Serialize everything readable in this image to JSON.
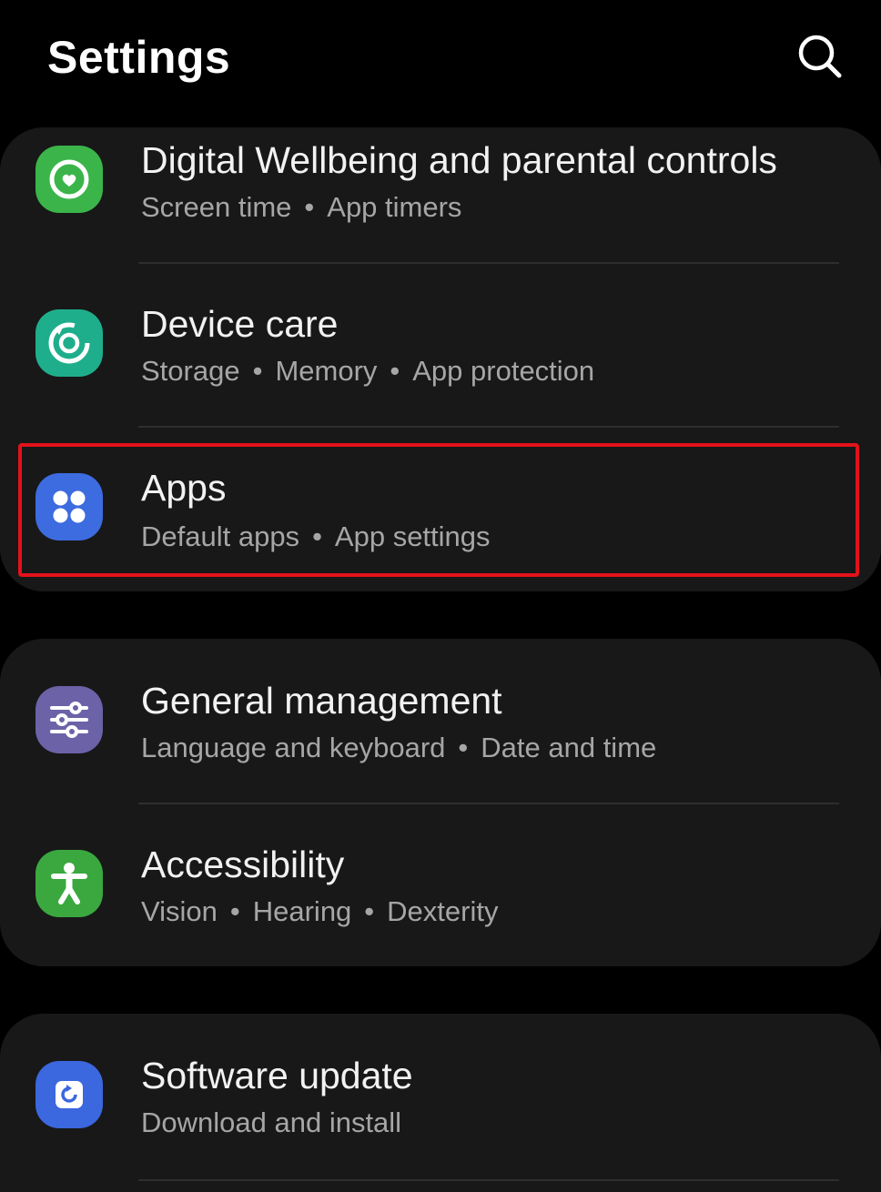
{
  "header": {
    "title": "Settings",
    "search_icon": "search-icon"
  },
  "groups": [
    {
      "items": [
        {
          "title": "Digital Wellbeing and parental controls",
          "subtitle_parts": [
            "Screen time",
            "App timers"
          ],
          "icon": "wellbeing-icon",
          "icon_color": "#3bb54a"
        },
        {
          "title": "Device care",
          "subtitle_parts": [
            "Storage",
            "Memory",
            "App protection"
          ],
          "icon": "device-care-icon",
          "icon_color": "#1fae8c"
        },
        {
          "title": "Apps",
          "subtitle_parts": [
            "Default apps",
            "App settings"
          ],
          "icon": "apps-icon",
          "icon_color": "#3d6ce0",
          "highlighted": true
        }
      ]
    },
    {
      "items": [
        {
          "title": "General management",
          "subtitle_parts": [
            "Language and keyboard",
            "Date and time"
          ],
          "icon": "sliders-icon",
          "icon_color": "#6b62a8"
        },
        {
          "title": "Accessibility",
          "subtitle_parts": [
            "Vision",
            "Hearing",
            "Dexterity"
          ],
          "icon": "accessibility-icon",
          "icon_color": "#3aa83f"
        }
      ]
    },
    {
      "items": [
        {
          "title": "Software update",
          "subtitle_parts": [
            "Download and install"
          ],
          "icon": "software-update-icon",
          "icon_color": "#3b67df"
        }
      ]
    }
  ],
  "colors": {
    "background": "#000000",
    "card": "#181818",
    "highlight": "#e3121a",
    "subtitle": "#a6a6a6"
  }
}
